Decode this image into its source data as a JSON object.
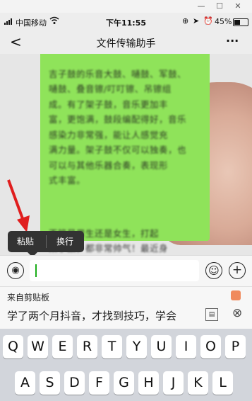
{
  "window": {
    "minimize_label": "—",
    "restore_label": "☐",
    "close_label": "✕"
  },
  "status": {
    "carrier": "中国移动",
    "time": "下午11:55",
    "battery": "45%"
  },
  "nav": {
    "back_label": "<",
    "title": "文件传输助手",
    "more_label": "···"
  },
  "message": {
    "text_top": "吉子鼓的乐音大鼓、嗵鼓、军鼓、\n嗵鼓、叠音镲/叮叮镲、吊镲组\n成。有了架子鼓，音乐更加丰\n富，更饱满，鼓段编配得好，音乐\n感染力非常强，能让人感觉充\n满力量。架子鼓不仅可以独奏，也\n可以与其他乐器合奏，表现形\n式丰富。",
    "text_bottom": "不管是男生还是女生，打起\n架子鼓，都非常帅气！最近身\n边有朋友在学习架子鼓，那轻重缓\n急的鼓点把我的心跳都给鼓动起来\n了。现在很想重新去学架子鼓，架\n子鼓打起来，快乐动起来！"
  },
  "popup": {
    "paste_label": "粘贴",
    "newline_label": "换行"
  },
  "input": {
    "voice_label": "◉",
    "emoji_label": "☺",
    "plus_label": "+"
  },
  "clipboard": {
    "header": "来自剪贴板",
    "preview": "学了两个月抖音，才找到技巧，学会",
    "close_label": "⊗"
  },
  "keyboard": {
    "row1": [
      "Q",
      "W",
      "E",
      "R",
      "T",
      "Y",
      "U",
      "I",
      "O",
      "P"
    ],
    "row2": [
      "A",
      "S",
      "D",
      "F",
      "G",
      "H",
      "J",
      "K",
      "L"
    ]
  }
}
